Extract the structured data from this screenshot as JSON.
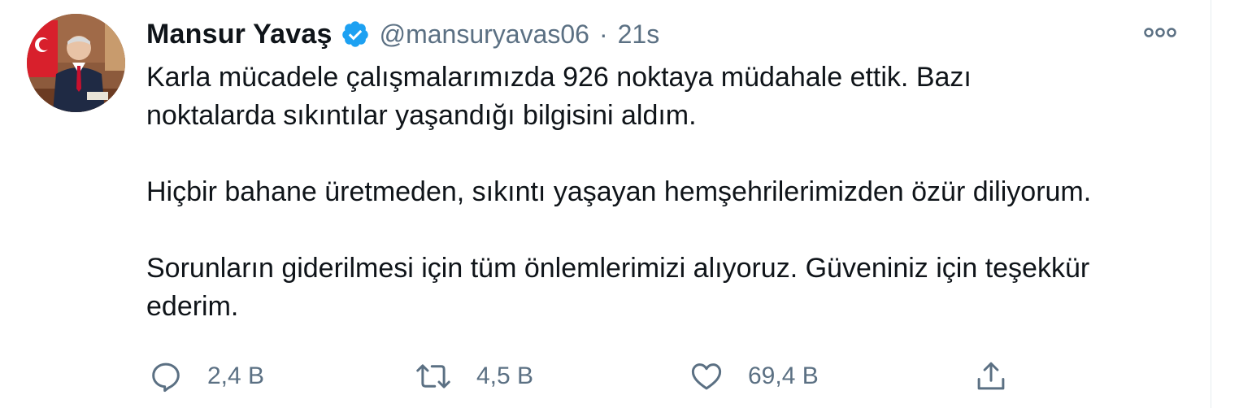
{
  "tweet": {
    "display_name": "Mansur Yavaş",
    "handle": "@mansuryavas06",
    "separator": "·",
    "time": "21s",
    "text_lines": [
      "Karla mücadele çalışmalarımızda 926 noktaya müdahale ettik. Bazı",
      "noktalarda sıkıntılar yaşandığı bilgisini aldım.",
      "Hiçbir bahane üretmeden, sıkıntı yaşayan hemşehrilerimizden özür diliyorum.",
      "Sorunların giderilmesi için tüm önlemlerimizi alıyoruz. Güveniniz için teşekkür",
      "ederim."
    ],
    "actions": {
      "reply_count": "2,4 B",
      "retweet_count": "4,5 B",
      "like_count": "69,4 B"
    },
    "icons": {
      "verified": "verified-badge-icon",
      "more": "more-options-icon",
      "reply": "reply-icon",
      "retweet": "retweet-icon",
      "like": "heart-icon",
      "share": "share-icon"
    },
    "colors": {
      "text": "#0f1419",
      "secondary": "#5b7083",
      "verified": "#1da1f2"
    }
  }
}
